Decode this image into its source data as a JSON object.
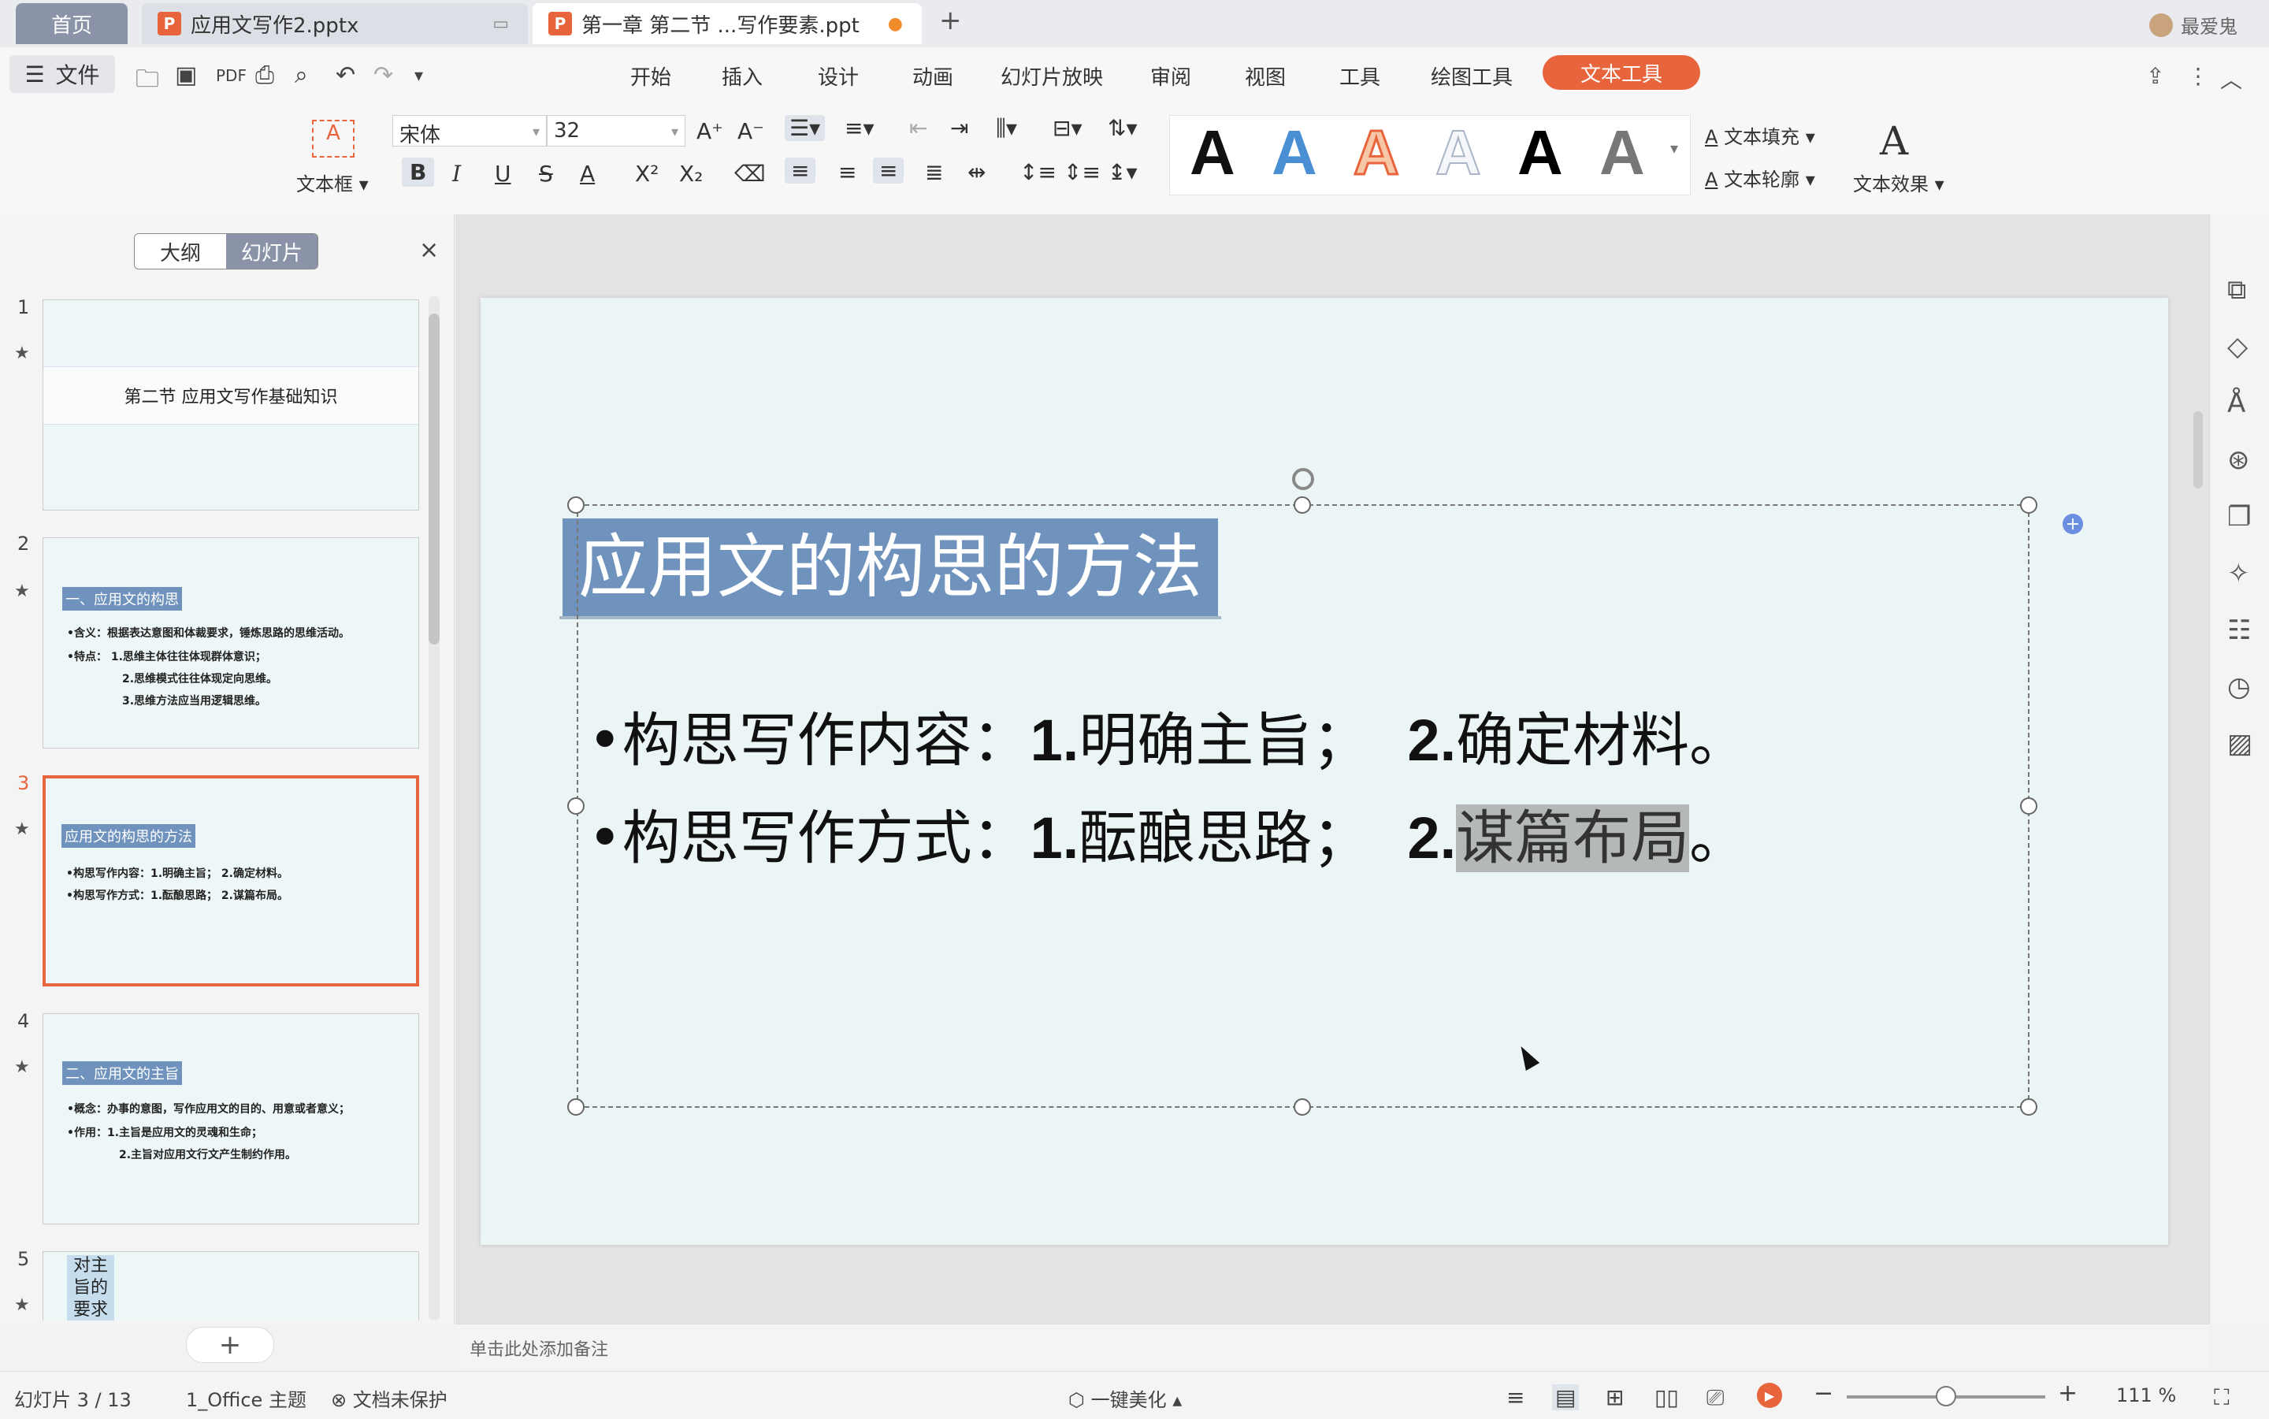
{
  "tabs": {
    "home": "首页",
    "file1": "应用文写作2.pptx",
    "file2": "第一章 第二节 ...写作要素.ppt",
    "add": "+",
    "user": "最爱鬼"
  },
  "menu": {
    "file": "文件",
    "items": [
      "开始",
      "插入",
      "设计",
      "动画",
      "幻灯片放映",
      "审阅",
      "视图",
      "工具",
      "绘图工具"
    ],
    "active": "文本工具"
  },
  "ribbon": {
    "textbox_label": "文本框",
    "font_name": "宋体",
    "font_size": "32",
    "text_fill": "文本填充",
    "text_outline": "文本轮廓",
    "text_effect": "文本效果"
  },
  "panel": {
    "seg_outline": "大纲",
    "seg_slides": "幻灯片",
    "close": "×",
    "add": "+"
  },
  "slides": [
    {
      "num": "1",
      "title": "第二节 应用文写作基础知识"
    },
    {
      "num": "2",
      "title": "一、应用文的构思",
      "lines": [
        "•含义：根据表达意图和体裁要求，锤炼思路的思维活动。",
        "•特点：    1.思维主体往往体现群体意识；",
        "2.思维模式往往体现定向思维。",
        "3.思维方法应当用逻辑思维。"
      ]
    },
    {
      "num": "3",
      "title": "应用文的构思的方法",
      "lines": [
        "•构思写作内容：1.明确主旨；    2.确定材料。",
        "•构思写作方式：1.酝酿思路；    2.谋篇布局。"
      ]
    },
    {
      "num": "4",
      "title": "二、应用文的主旨",
      "lines": [
        "•概念：办事的意图，写作应用文的目的、用意或者意义；",
        "•作用：1.主旨是应用文的灵魂和生命；",
        "2.主旨对应用文行文产生制约作用。"
      ]
    },
    {
      "num": "5",
      "title": "对主旨的要求"
    }
  ],
  "main_slide": {
    "title": "应用文的构思的方法",
    "b1_lead": "•构思写作内容：",
    "b1_n1": "1.",
    "b1_t1": "明确主旨；",
    "b1_n2": "2.",
    "b1_t2": "确定材料。",
    "b2_lead": "•构思写作方式：",
    "b2_n1": "1.",
    "b2_t1": "酝酿思路；",
    "b2_n2": "2.",
    "b2_t2": "谋篇布局",
    "b2_end": "。"
  },
  "notes_placeholder": "单击此处添加备注",
  "status": {
    "slide_count": "幻灯片 3 / 13",
    "theme": "1_Office 主题",
    "protect": "文档未保护",
    "beautify": "一键美化",
    "zoom": "111 %",
    "zoom_level": 0.5
  },
  "colors": {
    "accent": "#e8643c",
    "title_bg": "#6f93bd",
    "slide_bg": "#ebf5f5"
  }
}
